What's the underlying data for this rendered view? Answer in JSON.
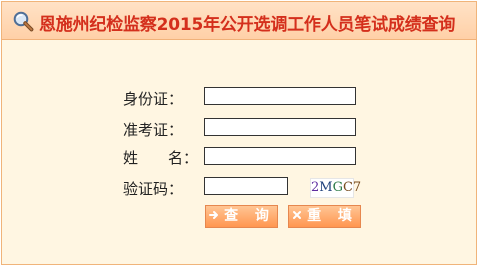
{
  "header": {
    "title": "恩施州纪检监察2015年公开选调工作人员笔试成绩查询"
  },
  "form": {
    "id_label": "身份证：",
    "exam_label": "准考证：",
    "name_label": "姓　　名：",
    "code_label": "验证码：",
    "id_value": "",
    "exam_value": "",
    "name_value": "",
    "code_value": "",
    "captcha": [
      "2",
      "M",
      "G",
      "C7"
    ]
  },
  "buttons": {
    "query": "查 询",
    "reset": "重 填"
  },
  "colors": {
    "title": "#d42f1c",
    "header_bg": "#ffd8b4",
    "panel_bg": "#fff6e2",
    "button": "#ff9650"
  },
  "icons": {
    "title": "magnifier-icon",
    "query": "arrow-right-icon",
    "reset": "close-icon"
  }
}
